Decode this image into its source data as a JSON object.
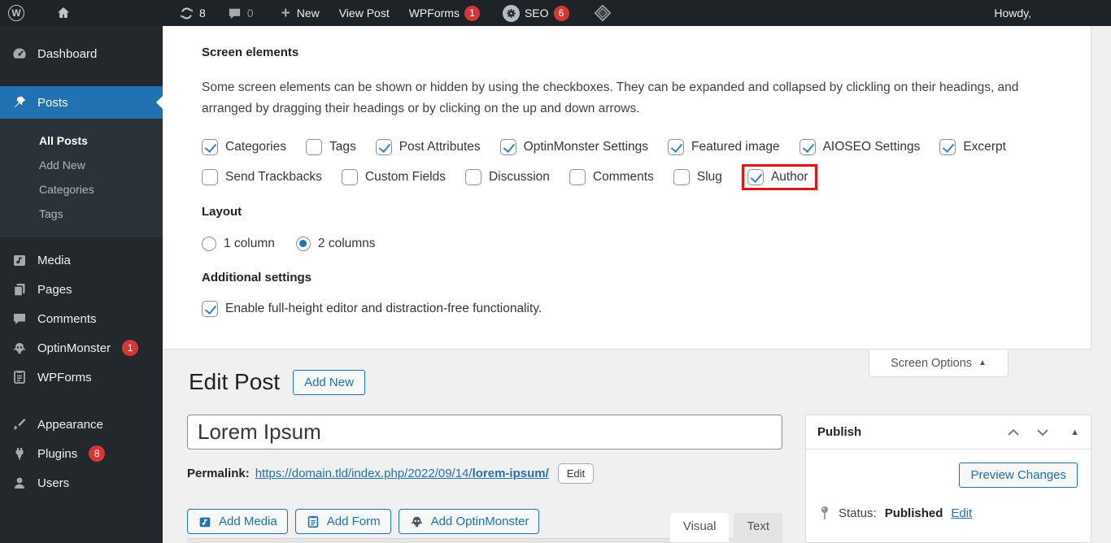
{
  "colors": {
    "accent": "#2271b1",
    "badge_red": "#d63638",
    "highlight_red": "#e01212",
    "check_blue": "#3582c4"
  },
  "admin_bar": {
    "wp_logo_letter": "W",
    "updates_count": "8",
    "comments_count": "0",
    "new_label": "New",
    "view_post": "View Post",
    "wpforms": "WPForms",
    "wpforms_badge": "1",
    "seo": "SEO",
    "seo_badge": "6",
    "howdy": "Howdy,"
  },
  "sidebar": {
    "dashboard": "Dashboard",
    "posts": "Posts",
    "submenu": {
      "all_posts": "All Posts",
      "add_new": "Add New",
      "categories": "Categories",
      "tags": "Tags"
    },
    "media": "Media",
    "pages": "Pages",
    "comments": "Comments",
    "optinmonster": "OptinMonster",
    "optinmonster_badge": "1",
    "wpforms": "WPForms",
    "appearance": "Appearance",
    "plugins": "Plugins",
    "plugins_badge": "8",
    "users": "Users"
  },
  "screen_options": {
    "heading": "Screen elements",
    "description_line1": "Some screen elements can be shown or hidden by using the checkboxes. They can be expanded and collapsed by clickling on their headings, and",
    "description_line2": "arranged by dragging their headings or by clicking on the up and down arrows.",
    "row1": [
      {
        "label": "Categories",
        "checked": true
      },
      {
        "label": "Tags",
        "checked": false
      },
      {
        "label": "Post Attributes",
        "checked": true
      },
      {
        "label": "OptinMonster Settings",
        "checked": true
      },
      {
        "label": "Featured image",
        "checked": true
      },
      {
        "label": "AIOSEO Settings",
        "checked": true
      },
      {
        "label": "Excerpt",
        "checked": true
      }
    ],
    "row2": [
      {
        "label": "Send Trackbacks",
        "checked": false
      },
      {
        "label": "Custom Fields",
        "checked": false
      },
      {
        "label": "Discussion",
        "checked": false
      },
      {
        "label": "Comments",
        "checked": false
      },
      {
        "label": "Slug",
        "checked": false
      },
      {
        "label": "Author",
        "checked": true,
        "highlighted": true
      }
    ],
    "layout_heading": "Layout",
    "layout_options": [
      {
        "label": "1 column",
        "selected": false
      },
      {
        "label": "2 columns",
        "selected": true
      }
    ],
    "additional_heading": "Additional settings",
    "additional_checkbox": "Enable full-height editor and distraction-free functionality.",
    "tab_label": "Screen Options"
  },
  "page": {
    "title": "Edit Post",
    "add_new": "Add New"
  },
  "editor": {
    "post_title": "Lorem Ipsum",
    "permalink_label": "Permalink:",
    "permalink_url": "https://domain.tld/index.php/2022/09/14/",
    "permalink_slug": "lorem-ipsum/",
    "permalink_edit": "Edit",
    "add_media": "Add Media",
    "add_form": "Add Form",
    "add_optinmonster": "Add OptinMonster",
    "tab_visual": "Visual",
    "tab_text": "Text"
  },
  "publish": {
    "heading": "Publish",
    "preview_changes": "Preview Changes",
    "status_label": "Status:",
    "status_value": "Published",
    "edit_link": "Edit"
  }
}
